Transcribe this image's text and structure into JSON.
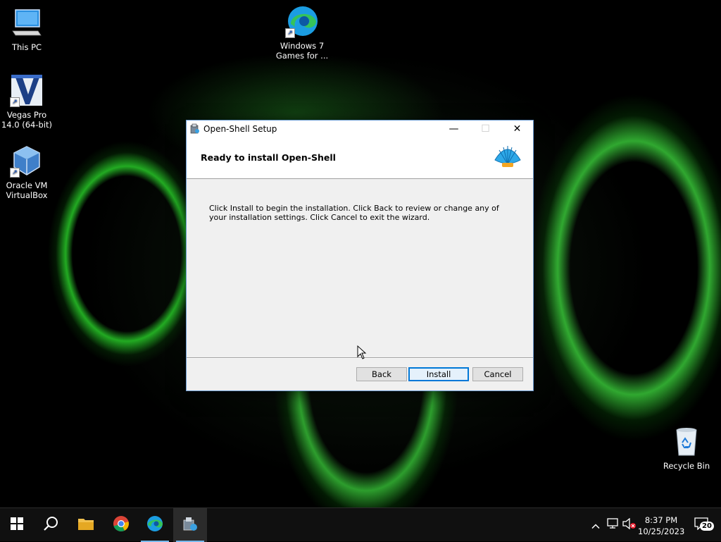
{
  "desktop": {
    "icons": [
      {
        "label": "This PC"
      },
      {
        "label": "Vegas Pro 14.0 (64-bit)"
      },
      {
        "label": "Oracle VM VirtualBox"
      },
      {
        "label": "Windows 7 Games for ..."
      },
      {
        "label": "Recycle Bin"
      }
    ]
  },
  "dialog": {
    "title": "Open-Shell Setup",
    "heading": "Ready to install Open-Shell",
    "body": "Click Install to begin the installation. Click Back to review or change any of your installation settings. Click Cancel to exit the wizard.",
    "buttons": {
      "back": "Back",
      "install": "Install",
      "cancel": "Cancel"
    }
  },
  "taskbar": {
    "items": [
      "start-icon",
      "search-icon",
      "file-explorer-icon",
      "chrome-icon",
      "edge-icon",
      "setup-installer-icon"
    ],
    "clock": {
      "time": "8:37 PM",
      "date": "10/25/2023"
    },
    "notification_count": "20"
  },
  "colors": {
    "accent": "#0078d7",
    "taskbar": "#101010",
    "dialog_bg": "#f0f0f0"
  }
}
